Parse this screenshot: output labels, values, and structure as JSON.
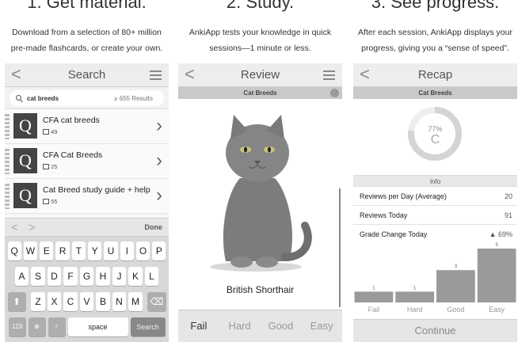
{
  "columns": [
    {
      "title": "1. Get material.",
      "desc_line1": "Download from a selection of 80+ million",
      "desc_line2": "pre-made flashcards, or create your own."
    },
    {
      "title": "2. Study.",
      "desc_line1": "AnkiApp tests your knowledge in quick",
      "desc_line2": "sessions—1 minute or less."
    },
    {
      "title": "3. See progress.",
      "desc_line1": "After each session, AnkiApp displays your",
      "desc_line2": "progress, giving you a “sense of speed”."
    }
  ],
  "nav": {
    "back_glyph": "<"
  },
  "search_screen": {
    "title": "Search",
    "query": "cat breeds",
    "result_count": "≥ 655 Results",
    "decks": [
      {
        "logo": "Q",
        "name": "CFA cat breeds",
        "count": "49"
      },
      {
        "logo": "Q",
        "name": "CFA Cat Breeds",
        "count": "25"
      },
      {
        "logo": "Q",
        "name": "Cat Breed study guide + help",
        "count": "55"
      }
    ],
    "chevron": "›",
    "kb_prev": "<",
    "kb_next": ">",
    "kb_done": "Done",
    "keyboard": {
      "row1": [
        "Q",
        "W",
        "E",
        "R",
        "T",
        "Y",
        "U",
        "I",
        "O",
        "P"
      ],
      "row2": [
        "A",
        "S",
        "D",
        "F",
        "G",
        "H",
        "J",
        "K",
        "L"
      ],
      "row3": [
        "Z",
        "X",
        "C",
        "V",
        "B",
        "N",
        "M"
      ],
      "shift": "⬆",
      "delete": "⌫",
      "numbers": "123",
      "globe": "⊕",
      "mic": "♂",
      "space": "space",
      "search": "Search"
    }
  },
  "review_screen": {
    "title": "Review",
    "deck": "Cat Breeds",
    "answer": "British Shorthair",
    "grades": [
      "Fail",
      "Hard",
      "Good",
      "Easy"
    ]
  },
  "recap_screen": {
    "title": "Recap",
    "deck": "Cat Breeds",
    "score": "77%",
    "score_fraction": 0.77,
    "grade": "C",
    "info_label": "Info",
    "stats": [
      {
        "label": "Reviews per Day (Average)",
        "value": "20"
      },
      {
        "label": "Reviews Today",
        "value": "91"
      },
      {
        "label": "Grade Change Today",
        "value": "▲ 69%"
      }
    ],
    "continue": "Continue"
  },
  "chart_data": {
    "type": "bar",
    "categories": [
      "Fail",
      "Hard",
      "Good",
      "Easy"
    ],
    "values": [
      1,
      1,
      3,
      5
    ],
    "ylim": [
      0,
      5
    ],
    "title": "",
    "xlabel": "",
    "ylabel": ""
  },
  "colors": {
    "bar": "#9a9a9a",
    "ring": "#d4d4d4",
    "ring_track": "#eeeeee"
  }
}
